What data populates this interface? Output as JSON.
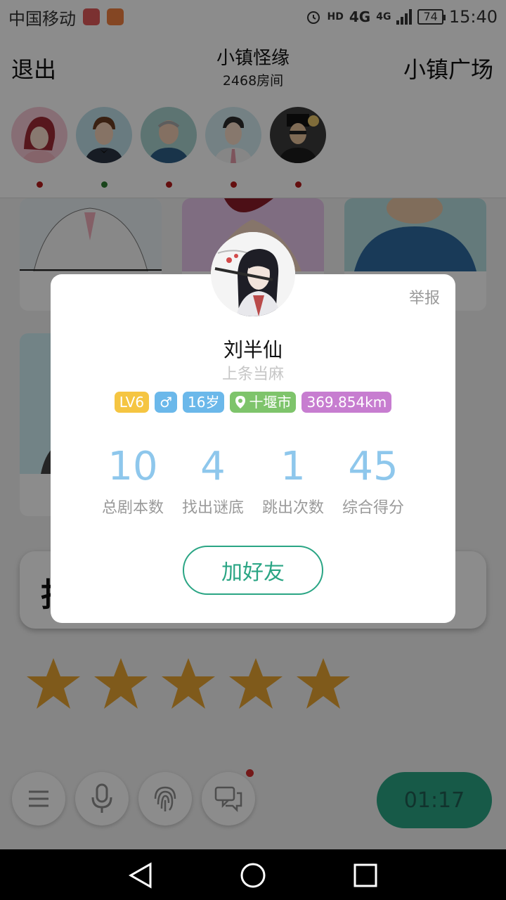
{
  "status_bar": {
    "carrier": "中国移动",
    "network_small": "HD",
    "network_4g": "4G",
    "network_4g_small": "4G",
    "battery": "74",
    "time": "15:40"
  },
  "header": {
    "exit_label": "退出",
    "room_title": "小镇怪缘",
    "room_sub": "2468房间",
    "plaza_label": "小镇广场"
  },
  "players": [
    {
      "status_color": "#b71c1c"
    },
    {
      "status_color": "#2e7d32"
    },
    {
      "status_color": "#b71c1c"
    },
    {
      "status_color": "#b71c1c"
    },
    {
      "status_color": "#b71c1c"
    }
  ],
  "clue_bar": {
    "char": "找"
  },
  "stars": {
    "count": 5,
    "color": "#e8a532"
  },
  "bottom": {
    "timer": "01:17",
    "icons": [
      "menu-icon",
      "microphone-icon",
      "fingerprint-icon",
      "chat-icon"
    ]
  },
  "dialog": {
    "report_label": "举报",
    "name": "刘半仙",
    "signature": "上条当麻",
    "tags": {
      "level": "LV6",
      "gender": "♂",
      "age": "16岁",
      "city": "十堰市",
      "distance": "369.854km"
    },
    "tag_colors": {
      "level": "#f5c542",
      "gender": "#6bb8ea",
      "age": "#6bb8ea",
      "city": "#7ec46b",
      "distance": "#c77dd0"
    },
    "stats": [
      {
        "value": "10",
        "label": "总剧本数"
      },
      {
        "value": "4",
        "label": "找出谜底"
      },
      {
        "value": "1",
        "label": "跳出次数"
      },
      {
        "value": "45",
        "label": "综合得分"
      }
    ],
    "add_friend_label": "加好友"
  }
}
